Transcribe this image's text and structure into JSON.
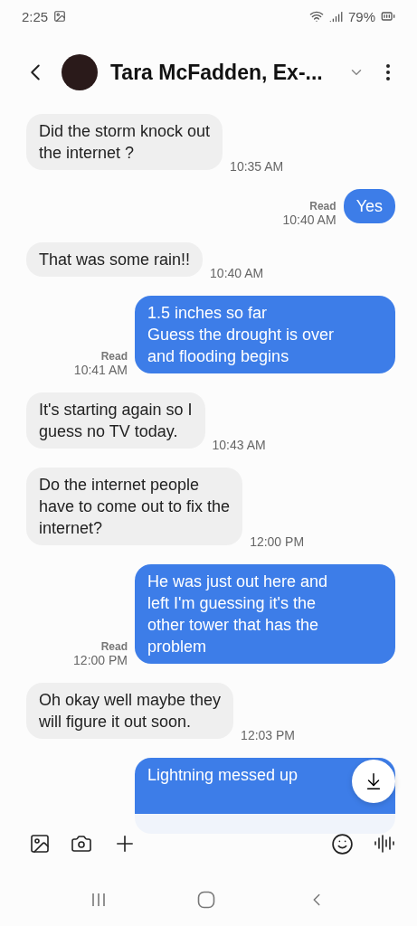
{
  "status_bar": {
    "time": "2:25",
    "battery": "79%"
  },
  "header": {
    "contact": "Tara McFadden, Ex-..."
  },
  "messages": [
    {
      "kind": "received",
      "text": "Did the storm  knock out\nthe internet ?",
      "time": "10:35 AM"
    },
    {
      "kind": "sent",
      "text": "Yes",
      "status": "Read",
      "time": "10:40 AM"
    },
    {
      "kind": "received",
      "text": "That was some rain!!",
      "time": "10:40 AM"
    },
    {
      "kind": "sent",
      "text": "1.5 inches so far\nGuess the drought is over\nand flooding begins",
      "status": "Read",
      "time": "10:41 AM"
    },
    {
      "kind": "received",
      "text": "It's starting again so I\nguess no TV today.",
      "time": "10:43 AM"
    },
    {
      "kind": "received",
      "text": "Do the internet people\nhave to come out to fix the\ninternet?",
      "time": "12:00 PM"
    },
    {
      "kind": "sent",
      "text": "He was just out here and\nleft I'm guessing it's the\nother tower that has the\nproblem",
      "status": "Read",
      "time": "12:00 PM"
    },
    {
      "kind": "received",
      "text": "Oh okay well maybe they\nwill figure it out soon.",
      "time": "12:03 PM"
    },
    {
      "kind": "sent",
      "text": "Lightning messed up"
    }
  ]
}
